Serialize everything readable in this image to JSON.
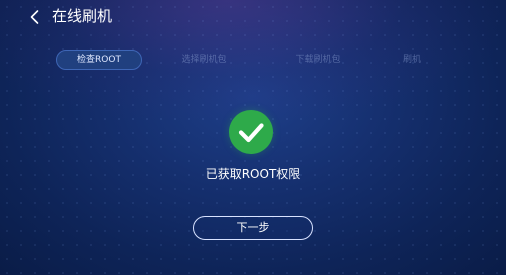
{
  "header": {
    "back_icon": "chevron-left-icon",
    "title": "在线刷机"
  },
  "steps": [
    {
      "label": "检查ROOT",
      "active": true
    },
    {
      "label": "选择刷机包",
      "active": false
    },
    {
      "label": "下载刷机包",
      "active": false
    },
    {
      "label": "刷机",
      "active": false
    }
  ],
  "status": {
    "icon": "check-icon",
    "icon_color": "#2eaa4a",
    "message": "已获取ROOT权限"
  },
  "actions": {
    "next_label": "下一步"
  },
  "colors": {
    "background": "#152f6e",
    "active_step_bg": "#20407f",
    "success": "#2eaa4a"
  }
}
